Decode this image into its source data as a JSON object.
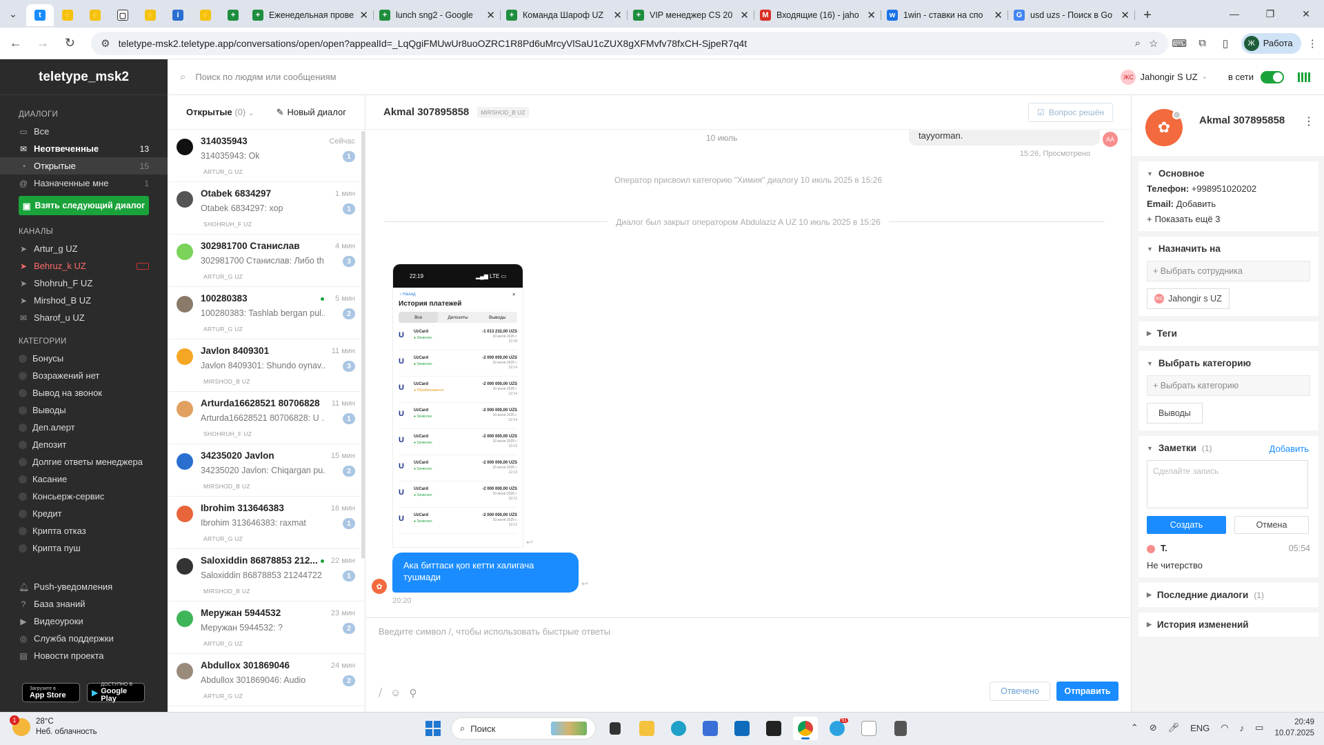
{
  "browser": {
    "tabs": [
      {
        "title": "Еженедельная прове",
        "color": "#1e8e3e",
        "glyph": "+"
      },
      {
        "title": "lunch sng2 - Google",
        "color": "#1e8e3e",
        "glyph": "+"
      },
      {
        "title": "Команда Шароф UZ",
        "color": "#1e8e3e",
        "glyph": "+"
      },
      {
        "title": "VIP менеджер CS 20",
        "color": "#1e8e3e",
        "glyph": "+"
      },
      {
        "title": "Входящие (16) - jaho",
        "color": "#d93025",
        "glyph": "M"
      },
      {
        "title": "1win - ставки на спо",
        "color": "#1a73e8",
        "glyph": "w"
      },
      {
        "title": "usd uzs - Поиск в Go",
        "color": "#4285f4",
        "glyph": "G"
      }
    ],
    "url": "teletype-msk2.teletype.app/conversations/open/open?appealId=_LqQgiFMUwUr8uoOZRC1R8Pd6uMrcyVlSaU1cZUX8gXFMvfv78fxCH-SjpeR7q4t",
    "profile_label": "Работа",
    "profile_initial": "Ж"
  },
  "sidebar": {
    "logo": "teletype_msk2",
    "dialogs_title": "ДИАЛОГИ",
    "dialogs": [
      {
        "label": "Все",
        "count": ""
      },
      {
        "label": "Неотвеченные",
        "count": "13"
      },
      {
        "label": "Открытые",
        "count": "15"
      },
      {
        "label": "Назначенные мне",
        "count": "1"
      }
    ],
    "next_button": "Взять следующий диалог",
    "channels_title": "КАНАЛЫ",
    "channels": [
      {
        "label": "Artur_g UZ"
      },
      {
        "label": "Behruz_k UZ"
      },
      {
        "label": "Shohruh_F UZ"
      },
      {
        "label": "Mirshod_B UZ"
      },
      {
        "label": "Sharof_u UZ"
      }
    ],
    "categories_title": "КАТЕГОРИИ",
    "categories": [
      "Бонусы",
      "Возражений нет",
      "Вывод на звонок",
      "Выводы",
      "Деп.алерт",
      "Депозит",
      "Долгие ответы менеджера",
      "Касание",
      "Консьерж-сервис",
      "Кредит",
      "Крипта отказ",
      "Крипта пуш"
    ],
    "bottom_links": [
      "Push-уведомления",
      "База знаний",
      "Видеоуроки",
      "Служба поддержки",
      "Новости проекта"
    ],
    "app_store": {
      "small": "Загрузите в",
      "big": "App Store"
    },
    "google_play": {
      "small": "ДОСТУПНО В",
      "big": "Google Play"
    }
  },
  "topbar": {
    "search_placeholder": "Поиск по людям или сообщениям",
    "user_initials": "ЖС",
    "user_name": "Jahongir S UZ",
    "status": "в сети"
  },
  "convlist": {
    "open_label": "Открытые",
    "open_count": "(0)",
    "new_dialog": "Новый диалог",
    "items": [
      {
        "name": "314035943",
        "time": "Сейчас",
        "preview": "314035943: Ok",
        "badge": "1",
        "op": "ARTUR_G UZ",
        "av": "#111",
        "online": false
      },
      {
        "name": "Otabek 6834297",
        "time": "1 мин",
        "preview": "Otabek 6834297: хор",
        "badge": "1",
        "op": "SHOHRUH_F UZ",
        "av": "#555",
        "online": false
      },
      {
        "name": "302981700 Станислав",
        "time": "4 мин",
        "preview": "302981700 Станислав: Либо th...",
        "badge": "3",
        "op": "ARTUR_G UZ",
        "av": "#7bd35a",
        "online": false
      },
      {
        "name": "100280383",
        "time": "5 мин",
        "preview": "100280383: Tashlab bergan pul...",
        "badge": "2",
        "op": "ARTUR_G UZ",
        "av": "#8a7a6a",
        "online": true
      },
      {
        "name": "Javlon 8409301",
        "time": "11 мин",
        "preview": "Javlon 8409301: Shundo oynav...",
        "badge": "3",
        "op": "MIRSHOD_B UZ",
        "av": "#f5a623",
        "online": false
      },
      {
        "name": "Arturda16628521 80706828",
        "time": "11 мин",
        "preview": "Arturda16628521 80706828: U ...",
        "badge": "1",
        "op": "SHOHRUH_F UZ",
        "av": "#e0a060",
        "online": false
      },
      {
        "name": "34235020 Javlon",
        "time": "15 мин",
        "preview": "34235020 Javlon: Chiqargan pu...",
        "badge": "2",
        "op": "MIRSHOD_B UZ",
        "av": "#2a6fd0",
        "online": false
      },
      {
        "name": "Ibrohim 313646383",
        "time": "16 мин",
        "preview": "Ibrohim 313646383: raxmat",
        "badge": "1",
        "op": "ARTUR_G UZ",
        "av": "#e8643a",
        "online": false
      },
      {
        "name": "Saloxiddin 86878853 212...",
        "time": "22 мин",
        "preview": "Saloxiddin 86878853 21244722 ...",
        "badge": "1",
        "op": "MIRSHOD_B UZ",
        "av": "#333",
        "online": true
      },
      {
        "name": "Меружан 5944532",
        "time": "23 мин",
        "preview": "Меружан 5944532: ?",
        "badge": "2",
        "op": "ARTUR_G UZ",
        "av": "#3fb55a",
        "online": false
      },
      {
        "name": "Abdullox 301869046",
        "time": "24 мин",
        "preview": "Abdullox 301869046: Audio",
        "badge": "2",
        "op": "ARTUR_G UZ",
        "av": "#9a8a7a",
        "online": false
      }
    ]
  },
  "chat": {
    "name": "Akmal 307895858",
    "tag": "MIRSHOD_B UZ",
    "resolved": "Вопрос решён",
    "date": "10 июль",
    "in_msg": "tayyorman.",
    "in_av": "АА",
    "in_meta": "15:26, Просмотрено",
    "sys1": "Оператор присвоил категорию \"Химия\" диалогу 10 июль 2025 в 15:26",
    "sys2": "Диалог был закрыт оператором Abdulaziz A UZ 10 июль 2025 в 15:26",
    "out_msg": "Ака биттаси қоп кетти халигача тушмади",
    "out_time": "20:20",
    "composer_placeholder": "Введите символ /, чтобы использовать быстрые ответы",
    "btn_answered": "Отвечено",
    "btn_send": "Отправить",
    "phone": {
      "time": "22:19",
      "net": "LTE",
      "back": "Назад",
      "title": "История платежей",
      "tabs": [
        "Все",
        "Депозиты",
        "Выводы"
      ],
      "rows": [
        {
          "bank": "UzCard",
          "status": "Зачислен",
          "amount": "-1 013 232,00 UZS",
          "date": "10 июля 2025 г.",
          "time": "12:18"
        },
        {
          "bank": "UzCard",
          "status": "Зачислен",
          "amount": "-2 000 000,00 UZS",
          "date": "10 июля 2025 г.",
          "time": "12:14"
        },
        {
          "bank": "UzCard",
          "status": "Обрабатывается",
          "amount": "-2 000 000,00 UZS",
          "date": "10 июля 2025 г.",
          "time": "12:14"
        },
        {
          "bank": "UzCard",
          "status": "Зачислен",
          "amount": "-2 000 000,00 UZS",
          "date": "10 июля 2025 г.",
          "time": "12:14"
        },
        {
          "bank": "UzCard",
          "status": "Зачислен",
          "amount": "-2 000 000,00 UZS",
          "date": "10 июля 2025 г.",
          "time": "12:13"
        },
        {
          "bank": "UzCard",
          "status": "Зачислен",
          "amount": "-2 000 000,00 UZS",
          "date": "10 июля 2025 г.",
          "time": "12:13"
        },
        {
          "bank": "UzCard",
          "status": "Зачислен",
          "amount": "-2 000 000,00 UZS",
          "date": "10 июля 2025 г.",
          "time": "12:12"
        },
        {
          "bank": "UzCard",
          "status": "Зачислен",
          "amount": "-2 000 000,00 UZS",
          "date": "10 июля 2025 г.",
          "time": "12:12"
        }
      ]
    }
  },
  "right": {
    "name": "Akmal 307895858",
    "basic_title": "Основное",
    "phone_label": "Телефон:",
    "phone_value": "+998951020202",
    "email_label": "Email:",
    "email_value": "Добавить",
    "show_more": "Показать ещё 3",
    "assign_title": "Назначить на",
    "assign_placeholder": "+ Выбрать сотрудника",
    "assignee": "Jahongir s UZ",
    "assignee_initials": "ЖС",
    "tags_title": "Теги",
    "category_title": "Выбрать категорию",
    "category_placeholder": "+ Выбрать категорию",
    "category_chip": "Выводы",
    "notes_title": "Заметки",
    "notes_count": "(1)",
    "notes_add": "Добавить",
    "notes_placeholder": "Сделайте запись",
    "btn_create": "Создать",
    "btn_cancel": "Отмена",
    "note_author": "Т.",
    "note_time": "05:54",
    "note_text": "Не читерство",
    "recent_title": "Последние диалоги",
    "recent_count": "(1)",
    "history_title": "История изменений"
  },
  "taskbar": {
    "temp": "28°C",
    "weather": "Неб. облачность",
    "weather_badge": "1",
    "search": "Поиск",
    "lang": "ENG",
    "time": "20:49",
    "date": "10.07.2025",
    "tg_badge": "91"
  }
}
